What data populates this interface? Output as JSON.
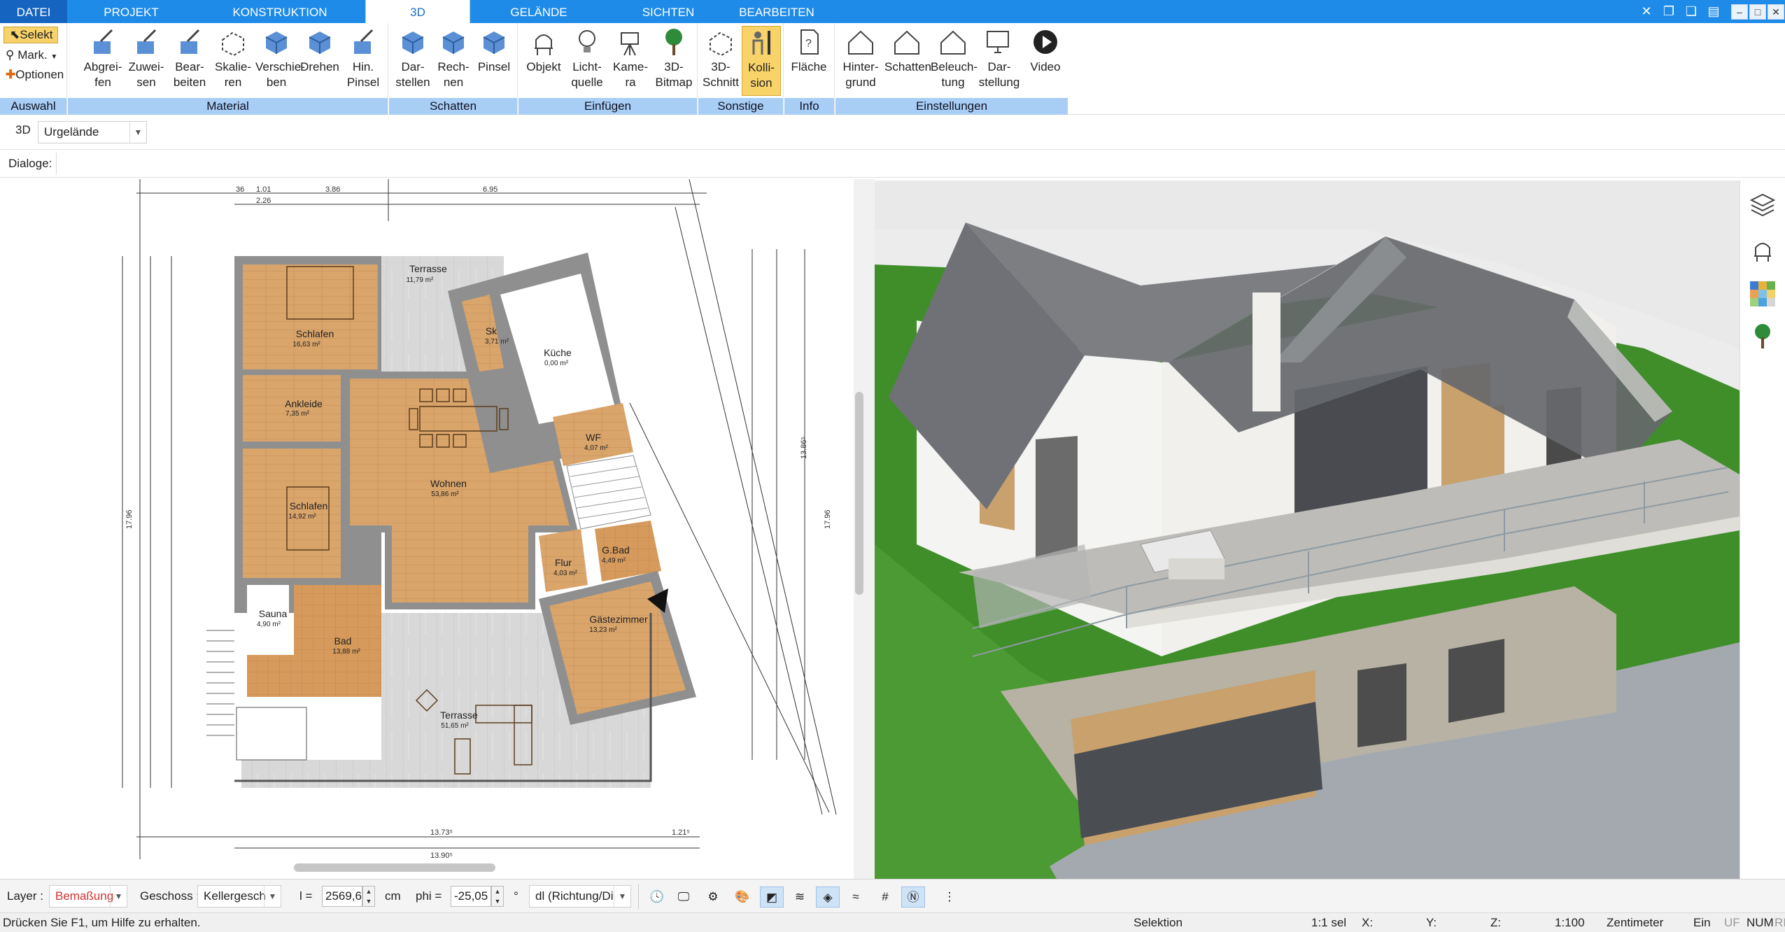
{
  "tabs": [
    {
      "label": "DATEI"
    },
    {
      "label": "PROJEKT"
    },
    {
      "label": "KONSTRUKTION"
    },
    {
      "label": "3D"
    },
    {
      "label": "GELÄNDE"
    },
    {
      "label": "SICHTEN"
    },
    {
      "label": "BEARBEITEN"
    }
  ],
  "ribbon": {
    "auswahl": {
      "group": "Auswahl",
      "select": "Selekt",
      "mark": "Mark.",
      "options": "Optionen"
    },
    "material": {
      "group": "Material",
      "buttons": [
        "Abgrei-\nfen",
        "Zuwei-\nsen",
        "Bear-\nbeiten",
        "Skalie-\nren",
        "Verschie-\nben",
        "Drehen",
        "Hin.\nPinsel"
      ]
    },
    "schatten": {
      "group": "Schatten",
      "buttons": [
        "Dar-\nstellen",
        "Rech-\nnen",
        "Pinsel"
      ]
    },
    "einfuegen": {
      "group": "Einfügen",
      "buttons": [
        "Objekt",
        "Licht-\nquelle",
        "Kame-\nra",
        "3D-\nBitmap"
      ]
    },
    "sonstige": {
      "group": "Sonstige",
      "buttons": [
        "3D-\nSchnitt",
        "Kolli-\nsion"
      ]
    },
    "info": {
      "group": "Info",
      "buttons": [
        "Fläche"
      ]
    },
    "einstellungen": {
      "group": "Einstellungen",
      "buttons": [
        "Hinter-\ngrund",
        "Schatten",
        "Beleuch-\ntung",
        "Dar-\nstellung",
        "Video"
      ]
    }
  },
  "toolbar2": {
    "mode": "3D",
    "layer_select": "Urgelände"
  },
  "toolbar3": {
    "dialoge_label": "Dialoge:"
  },
  "plan": {
    "rooms": [
      {
        "name": "Terrasse",
        "area": "11,79 m²"
      },
      {
        "name": "Schlafen",
        "area": "16,63 m²"
      },
      {
        "name": "Sk",
        "area": "3,71 m²"
      },
      {
        "name": "Küche",
        "area": "0,00 m²"
      },
      {
        "name": "Ankleide",
        "area": "7,35 m²"
      },
      {
        "name": "WF",
        "area": "4,07 m²"
      },
      {
        "name": "Wohnen",
        "area": "53,86 m²"
      },
      {
        "name": "Schlafen",
        "area": "14,92 m²"
      },
      {
        "name": "G.Bad",
        "area": "4,49 m²"
      },
      {
        "name": "Flur",
        "area": "4,03 m²"
      },
      {
        "name": "Sauna",
        "area": "4,90 m²"
      },
      {
        "name": "Gästezimmer",
        "area": "13,23 m²"
      },
      {
        "name": "Bad",
        "area": "13,88 m²"
      },
      {
        "name": "Terrasse",
        "area": "51,65 m²"
      }
    ],
    "dims_top": [
      "36",
      "1.01",
      "3.86",
      "6.95"
    ],
    "dims_top2": [
      "2.26"
    ],
    "dims_bottom": [
      "13.73⁵",
      "1.21⁵",
      "13.90⁵"
    ],
    "dims_left": [
      "17.96"
    ],
    "dims_right": [
      "17.96",
      "13.86⁵"
    ]
  },
  "bottombar": {
    "layer_label": "Layer :",
    "layer_value": "Bemaßung",
    "geschoss_label": "Geschoss :",
    "geschoss_value": "Kellergesch",
    "l_label": "l =",
    "l_value": "2569,6",
    "l_unit": "cm",
    "phi_label": "phi =",
    "phi_value": "-25,05",
    "phi_unit": "°",
    "dl_value": "dl (Richtung/Di"
  },
  "statusbar": {
    "help": "Drücken Sie F1, um Hilfe zu erhalten.",
    "mode": "Selektion",
    "sel": "1:1 sel",
    "x": "X:",
    "y": "Y:",
    "z": "Z:",
    "scale": "1:100",
    "unit": "Zentimeter",
    "ein": "Ein",
    "uf": "UF",
    "num": "NUM",
    "ri": "RI"
  },
  "colors": {
    "accent": "#1e8be8",
    "group_label": "#a9cef5",
    "active_button": "#f7d36a",
    "floor_wood": "#d9a56b",
    "wall": "#8f8f8f",
    "terrace": "#d3d3d3"
  }
}
